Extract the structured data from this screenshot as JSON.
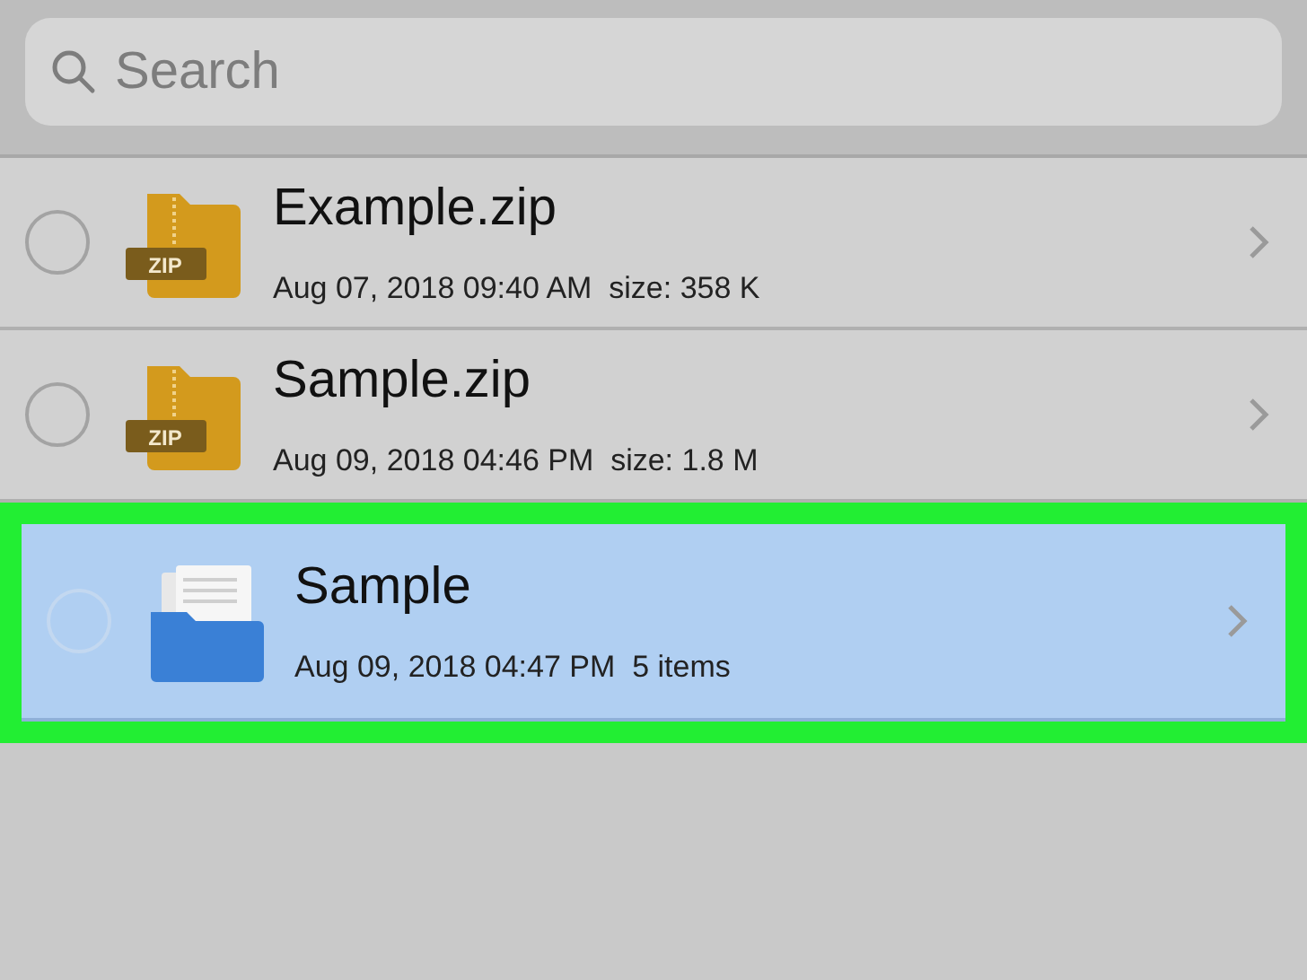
{
  "search": {
    "placeholder": "Search"
  },
  "files": [
    {
      "kind": "zip",
      "badge": "ZIP",
      "name": "Example.zip",
      "meta": "Aug 07, 2018 09:40 AM  size: 358 K",
      "selected": false,
      "highlighted": false
    },
    {
      "kind": "zip",
      "badge": "ZIP",
      "name": "Sample.zip",
      "meta": "Aug 09, 2018 04:46 PM  size: 1.8 M",
      "selected": false,
      "highlighted": false
    },
    {
      "kind": "folder",
      "name": "Sample",
      "meta": "Aug 09, 2018 04:47 PM  5 items",
      "selected": true,
      "highlighted": true
    }
  ]
}
